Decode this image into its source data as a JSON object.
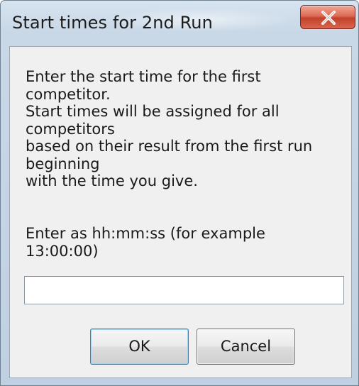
{
  "window": {
    "title": "Start times for 2nd Run",
    "close_icon": "close-icon"
  },
  "dialog": {
    "message_lines": [
      "Enter the start time for the first",
      "competitor.",
      "Start times will be assigned for all",
      "competitors",
      "based on their result from the first run",
      "beginning",
      "with the time you give."
    ],
    "prompt_lines": [
      "Enter as hh:mm:ss  (for example",
      "13:00:00)"
    ],
    "time_input": {
      "value": "",
      "placeholder": ""
    },
    "buttons": {
      "ok_label": "OK",
      "cancel_label": "Cancel"
    }
  },
  "colors": {
    "frame": "#bfd0e2",
    "client_background": "#f0f0f0",
    "close_button": "#c3412b"
  }
}
